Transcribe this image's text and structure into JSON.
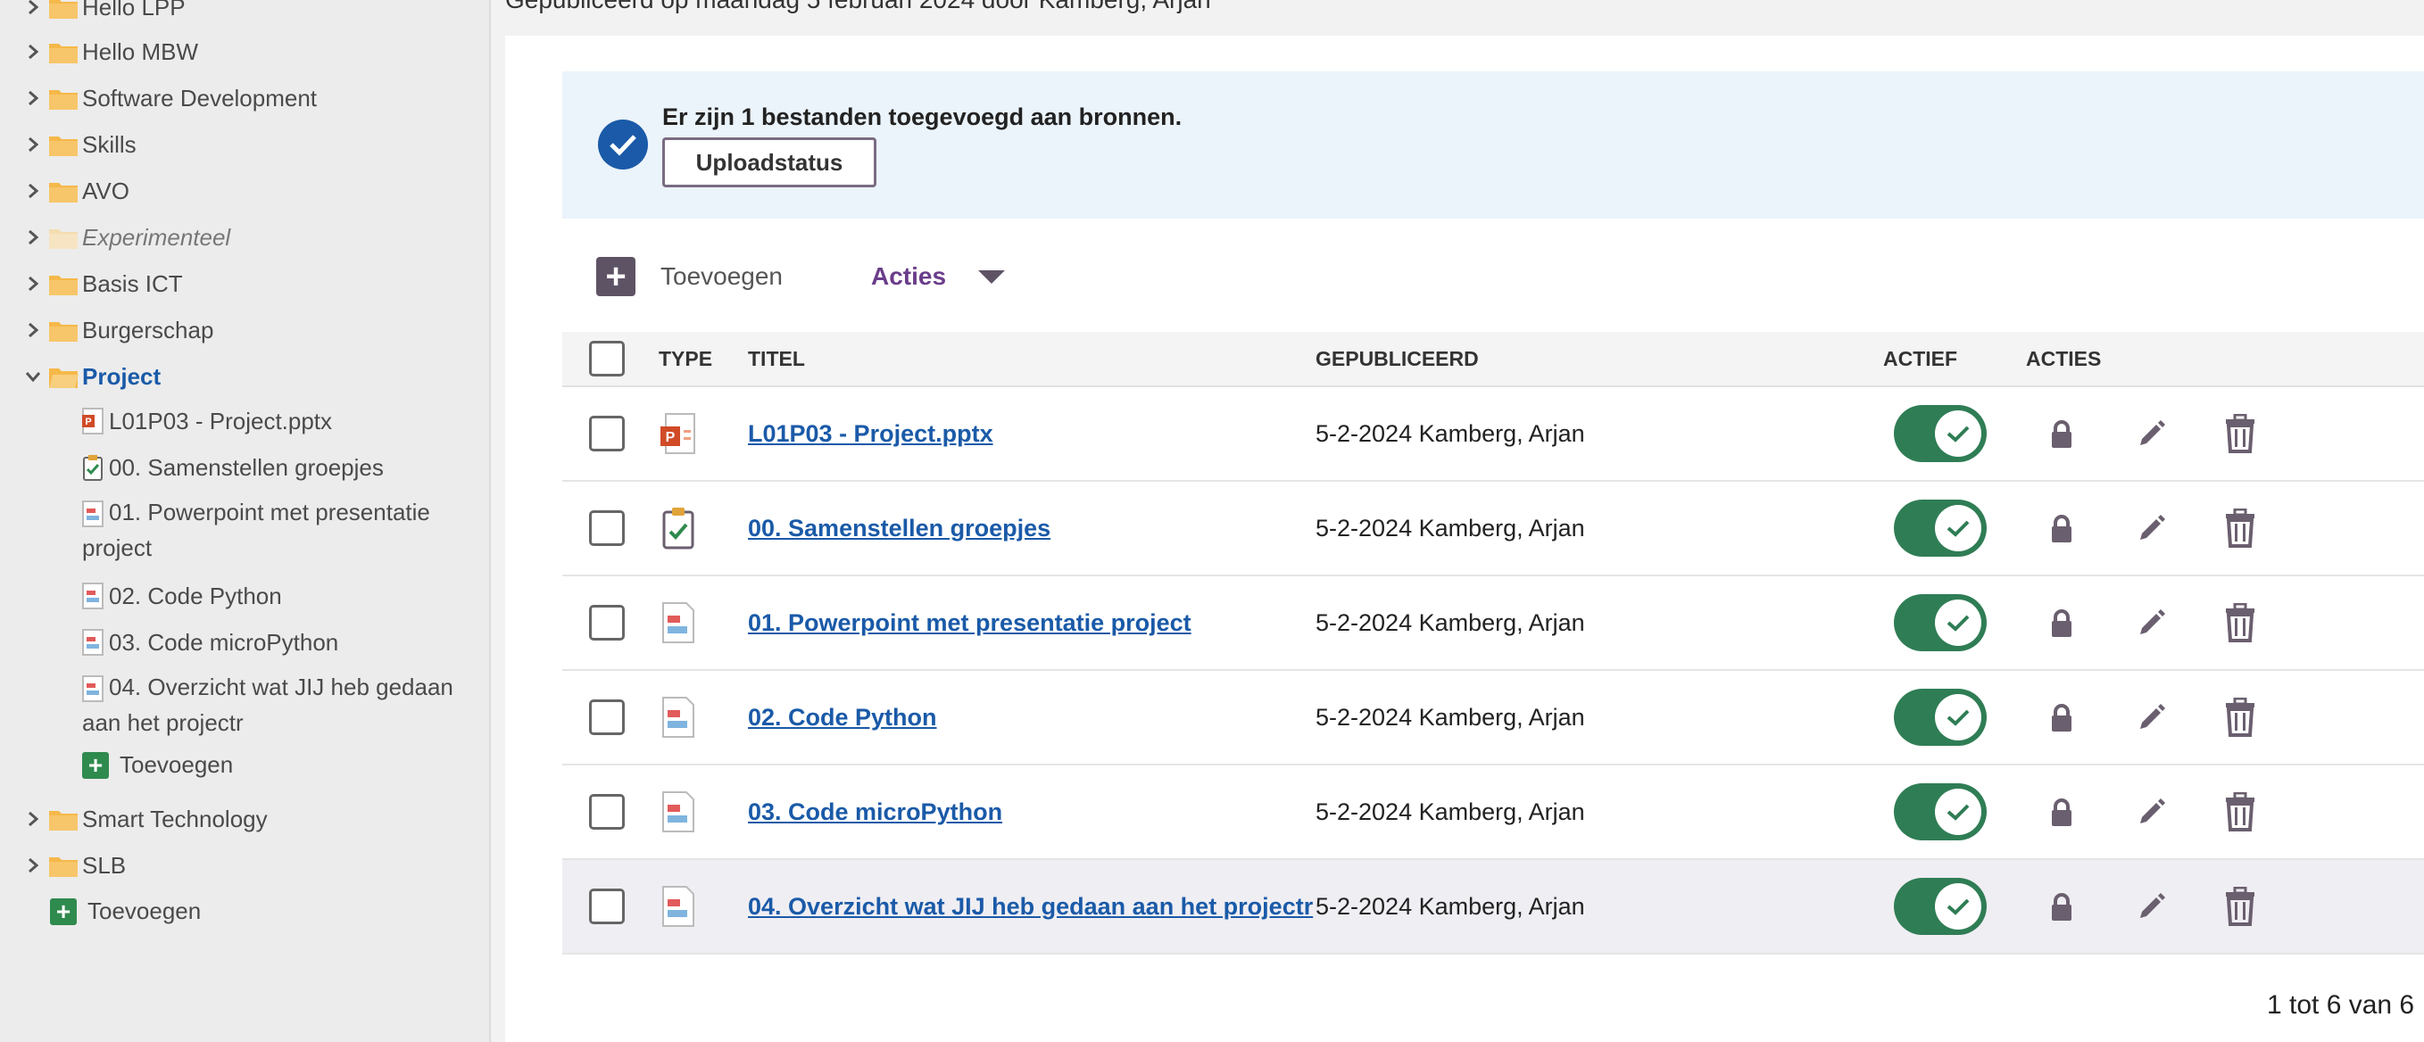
{
  "topstrip": "Gepubliceerd op maandag 5 februari 2024 door Kamberg, Arjan",
  "sidebar": {
    "folders_top": [
      {
        "label": "Hello LPP"
      },
      {
        "label": "Hello MBW"
      },
      {
        "label": "Software Development"
      },
      {
        "label": "Skills"
      },
      {
        "label": "AVO"
      },
      {
        "label": "Experimenteel"
      },
      {
        "label": "Basis ICT"
      },
      {
        "label": "Burgerschap"
      },
      {
        "label": "Project"
      }
    ],
    "project_children": [
      {
        "label": "L01P03 - Project.pptx"
      },
      {
        "label": "00. Samenstellen groepjes"
      },
      {
        "label": "01. Powerpoint met presentatie project"
      },
      {
        "label": "02. Code Python"
      },
      {
        "label": "03. Code microPython"
      },
      {
        "label": "04. Overzicht wat JIJ heb gedaan aan het projectr"
      }
    ],
    "project_add": "Toevoegen",
    "folders_bottom": [
      {
        "label": "Smart Technology"
      },
      {
        "label": "SLB"
      }
    ],
    "root_add": "Toevoegen"
  },
  "notice": {
    "message": "Er zijn 1 bestanden toegevoegd aan bronnen.",
    "button": "Uploadstatus"
  },
  "toolbar": {
    "add": "Toevoegen",
    "actions": "Acties"
  },
  "table": {
    "headers": {
      "type": "TYPE",
      "title": "TITEL",
      "published": "GEPUBLICEERD",
      "active": "ACTIEF",
      "actions": "ACTIES"
    },
    "rows": [
      {
        "title": "L01P03 - Project.pptx",
        "published": "5-2-2024 Kamberg, Arjan",
        "type": "pptx-icon",
        "active": true
      },
      {
        "title": "00. Samenstellen groepjes",
        "published": "5-2-2024 Kamberg, Arjan",
        "type": "assignment-icon",
        "active": true
      },
      {
        "title": "01. Powerpoint met presentatie project",
        "published": "5-2-2024 Kamberg, Arjan",
        "type": "page-icon",
        "active": true
      },
      {
        "title": "02. Code Python",
        "published": "5-2-2024 Kamberg, Arjan",
        "type": "page-icon",
        "active": true
      },
      {
        "title": "03. Code microPython",
        "published": "5-2-2024 Kamberg, Arjan",
        "type": "page-icon",
        "active": true
      },
      {
        "title": "04. Overzicht wat JIJ heb gedaan aan het projectr",
        "published": "5-2-2024 Kamberg, Arjan",
        "type": "page-icon",
        "active": true
      }
    ]
  },
  "pager": "1 tot 6 van 6",
  "colors": {
    "accent": "#1a5aa8",
    "toggle": "#2f7d55",
    "folder": "#f5b84a",
    "add_green": "#2f8a4e",
    "acties": "#6a3d8a"
  }
}
